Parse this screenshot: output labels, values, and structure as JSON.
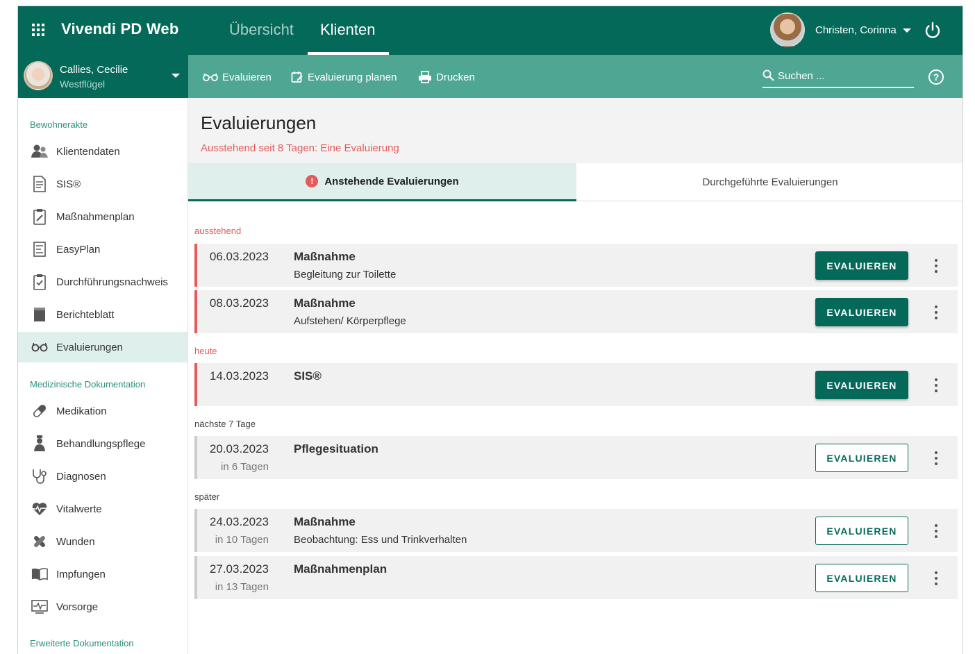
{
  "app": {
    "title": "Vivendi PD Web"
  },
  "nav": {
    "tabs": [
      {
        "label": "Übersicht"
      },
      {
        "label": "Klienten"
      }
    ]
  },
  "user": {
    "name": "Christen, Corinna"
  },
  "client": {
    "name": "Callies, Cecilie",
    "unit": "Westflügel"
  },
  "toolbar": {
    "evaluate_label": "Evaluieren",
    "plan_label": "Evaluierung planen",
    "print_label": "Drucken",
    "search_placeholder": "Suchen ...",
    "help": "?"
  },
  "sidebar": {
    "sections": [
      {
        "title": "Bewohnerakte"
      },
      {
        "title": "Medizinische Dokumentation"
      },
      {
        "title": "Erweiterte Dokumentation"
      }
    ],
    "items": [
      {
        "label": "Klientendaten",
        "icon": "client-data-icon"
      },
      {
        "label": "SIS®",
        "icon": "document-icon"
      },
      {
        "label": "Maßnahmenplan",
        "icon": "clipboard-edit-icon"
      },
      {
        "label": "EasyPlan",
        "icon": "easyplan-icon"
      },
      {
        "label": "Durchführungsnachweis",
        "icon": "clipboard-check-icon"
      },
      {
        "label": "Berichteblatt",
        "icon": "report-sheet-icon"
      },
      {
        "label": "Evaluierungen",
        "icon": "glasses-icon",
        "active": true
      },
      {
        "label": "Medikation",
        "icon": "pill-icon"
      },
      {
        "label": "Behandlungspflege",
        "icon": "nurse-icon"
      },
      {
        "label": "Diagnosen",
        "icon": "stethoscope-icon"
      },
      {
        "label": "Vitalwerte",
        "icon": "heart-pulse-icon"
      },
      {
        "label": "Wunden",
        "icon": "bandage-icon"
      },
      {
        "label": "Impfungen",
        "icon": "book-icon"
      },
      {
        "label": "Vorsorge",
        "icon": "monitor-pulse-icon"
      }
    ]
  },
  "page": {
    "title": "Evaluierungen",
    "overdue_note": "Ausstehend seit 8 Tagen: Eine Evaluierung"
  },
  "subtabs": [
    {
      "label": "Anstehende Evaluierungen",
      "alert": "!"
    },
    {
      "label": "Durchgeführte Evaluierungen"
    }
  ],
  "groups": [
    {
      "label": "ausstehend"
    },
    {
      "label": "heute"
    },
    {
      "label": "nächste 7 Tage"
    },
    {
      "label": "später"
    }
  ],
  "rows": [
    {
      "date": "06.03.2023",
      "relative": "",
      "type": "Maßnahme",
      "description": "Begleitung zur Toilette",
      "button": "EVALUIEREN"
    },
    {
      "date": "08.03.2023",
      "relative": "",
      "type": "Maßnahme",
      "description": "Aufstehen/ Körperpflege",
      "button": "EVALUIEREN"
    },
    {
      "date": "14.03.2023",
      "relative": "",
      "type": "SIS®",
      "description": "",
      "button": "EVALUIEREN"
    },
    {
      "date": "20.03.2023",
      "relative": "in 6 Tagen",
      "type": "Pflegesituation",
      "description": "",
      "button": "EVALUIEREN"
    },
    {
      "date": "24.03.2023",
      "relative": "in 10 Tagen",
      "type": "Maßnahme",
      "description": "Beobachtung: Ess und Trinkverhalten",
      "button": "EVALUIEREN"
    },
    {
      "date": "27.03.2023",
      "relative": "in 13 Tagen",
      "type": "Maßnahmenplan",
      "description": "",
      "button": "EVALUIEREN"
    }
  ],
  "colors": {
    "primary": "#05695a",
    "secondary": "#4fa793",
    "active_bg": "#dff0ec",
    "alert": "#e35b5b"
  }
}
